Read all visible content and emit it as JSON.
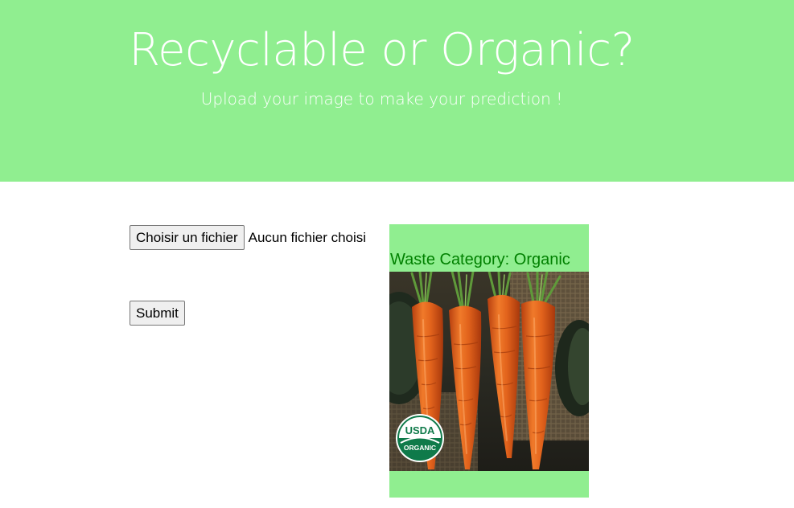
{
  "header": {
    "title": "Recyclable or Organic?",
    "subtitle": "Upload your image to make your prediction !"
  },
  "form": {
    "file_button_label": "Choisir un fichier",
    "file_status": "Aucun fichier choisi",
    "submit_label": "Submit"
  },
  "result": {
    "label": "Waste Category: Organic",
    "badge_line1": "USDA",
    "badge_line2": "ORGANIC"
  },
  "colors": {
    "header_bg": "#90ee90",
    "result_text": "#008000"
  }
}
